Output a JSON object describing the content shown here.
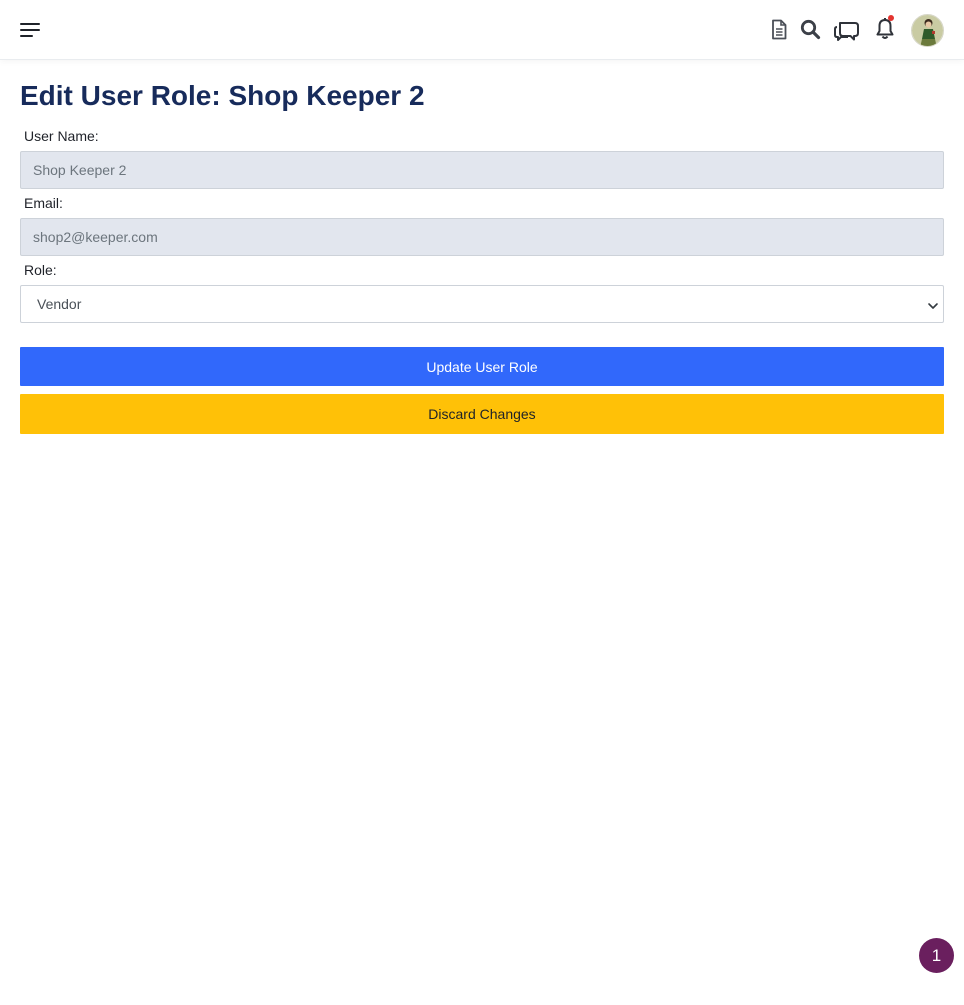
{
  "header": {
    "icons": [
      "menu-icon",
      "document-icon",
      "search-icon",
      "chat-icon",
      "bell-icon",
      "avatar"
    ],
    "notification_indicator_color": "#e3342f"
  },
  "page": {
    "title": "Edit User Role: Shop Keeper 2"
  },
  "form": {
    "user_name_label": "User Name:",
    "user_name_value": "Shop Keeper 2",
    "email_label": "Email:",
    "email_value": "shop2@keeper.com",
    "role_label": "Role:",
    "role_value": "Vendor",
    "update_label": "Update User Role",
    "discard_label": "Discard Changes"
  },
  "floating_badge": {
    "count": "1"
  },
  "colors": {
    "title": "#172b5b",
    "primary_button": "#3168fb",
    "warning_button": "#ffc107",
    "readonly_field": "#e2e6ee",
    "badge": "#6a1f5e"
  }
}
